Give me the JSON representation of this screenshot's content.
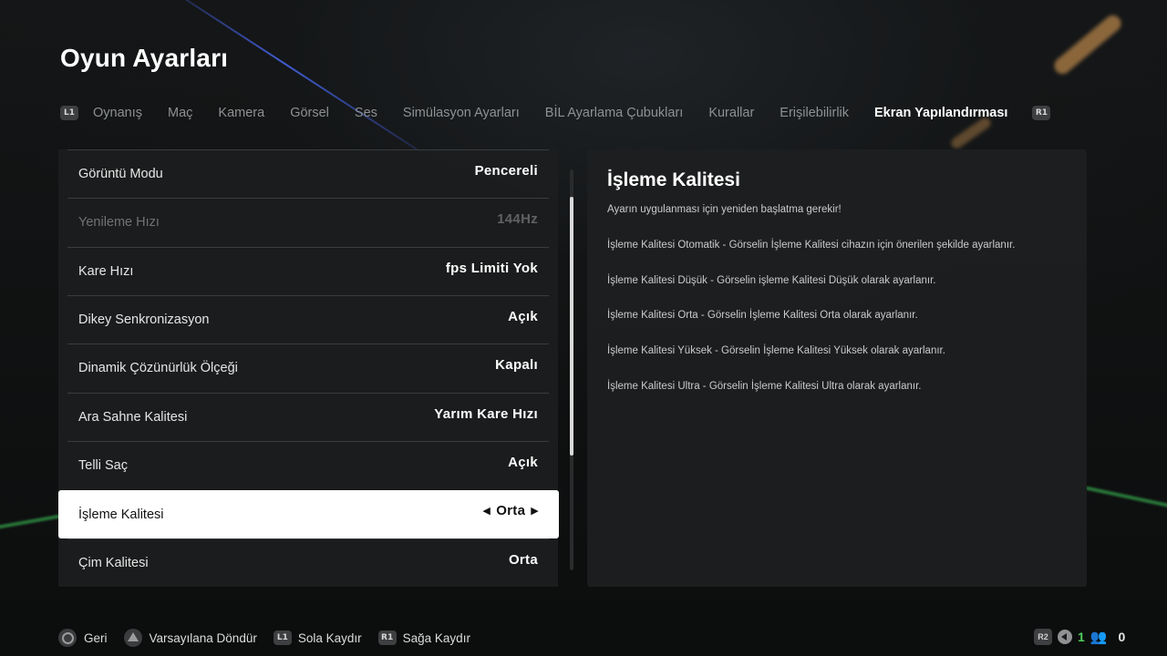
{
  "page_title": "Oyun Ayarları",
  "tabs": {
    "left_bumper": "L1",
    "right_bumper": "R1",
    "items": [
      {
        "label": "Oynanış"
      },
      {
        "label": "Maç"
      },
      {
        "label": "Kamera"
      },
      {
        "label": "Görsel"
      },
      {
        "label": "Ses"
      },
      {
        "label": "Simülasyon Ayarları"
      },
      {
        "label": "BİL Ayarlama Çubukları"
      },
      {
        "label": "Kurallar"
      },
      {
        "label": "Erişilebilirlik"
      },
      {
        "label": "Ekran Yapılandırması"
      }
    ],
    "active_index": 9
  },
  "settings": [
    {
      "label": "Görüntü Modu",
      "value": "Pencereli",
      "enabled": true
    },
    {
      "label": "Yenileme Hızı",
      "value": "144Hz",
      "enabled": false
    },
    {
      "label": "Kare Hızı",
      "value": "fps Limiti Yok",
      "enabled": true
    },
    {
      "label": "Dikey Senkronizasyon",
      "value": "Açık",
      "enabled": true
    },
    {
      "label": "Dinamik Çözünürlük Ölçeği",
      "value": "Kapalı",
      "enabled": true
    },
    {
      "label": "Ara Sahne Kalitesi",
      "value": "Yarım Kare Hızı",
      "enabled": true
    },
    {
      "label": "Telli Saç",
      "value": "Açık",
      "enabled": true
    },
    {
      "label": "İşleme Kalitesi",
      "value": "Orta",
      "enabled": true,
      "selected": true
    },
    {
      "label": "Çim Kalitesi",
      "value": "Orta",
      "enabled": true
    }
  ],
  "description": {
    "title": "İşleme Kalitesi",
    "lines": [
      "Ayarın uygulanması için yeniden başlatma gerekir!",
      "İşleme Kalitesi Otomatik - Görselin İşleme Kalitesi cihazın için önerilen şekilde ayarlanır.",
      "İşleme Kalitesi Düşük - Görselin işleme Kalitesi Düşük olarak ayarlanır.",
      "İşleme Kalitesi Orta - Görselin İşleme Kalitesi Orta olarak ayarlanır.",
      "İşleme Kalitesi Yüksek - Görselin İşleme Kalitesi Yüksek olarak ayarlanır.",
      "İşleme Kalitesi Ultra - Görselin İşleme Kalitesi Ultra olarak ayarlanır."
    ]
  },
  "footer": {
    "back_label": "Geri",
    "reset_label": "Varsayılana Döndür",
    "scroll_left_badge": "L1",
    "scroll_left_label": "Sola Kaydır",
    "scroll_right_badge": "R1",
    "scroll_right_label": "Sağa Kaydır"
  },
  "status": {
    "r2_badge": "R2",
    "green_value": "1",
    "friends_count": "0"
  },
  "colors": {
    "background": "#0d0e0e",
    "panel": "#1c1d1e",
    "selected_row": "#ffffff",
    "accent_green": "#4fcf5f"
  }
}
